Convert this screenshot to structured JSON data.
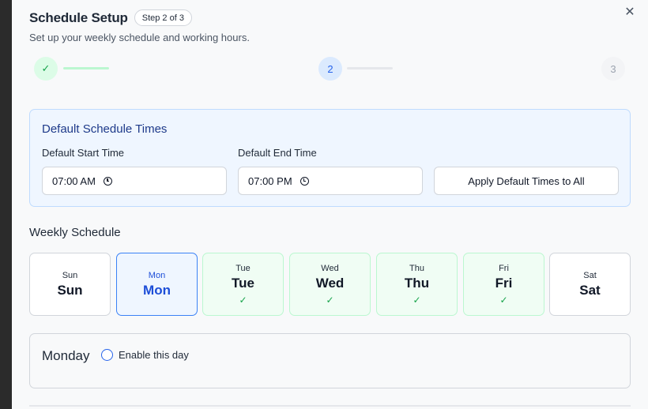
{
  "modal": {
    "title": "Schedule Setup",
    "step_badge": "Step 2 of 3",
    "subtitle": "Set up your weekly schedule and working hours.",
    "close_icon": "✕"
  },
  "stepper": {
    "steps": [
      {
        "label": "✓",
        "state": "complete"
      },
      {
        "label": "2",
        "state": "current"
      },
      {
        "label": "3",
        "state": "upcoming"
      }
    ]
  },
  "defaults": {
    "title": "Default Schedule Times",
    "start_label": "Default Start Time",
    "start_value": "07:00 AM",
    "end_label": "Default End Time",
    "end_value": "07:00 PM",
    "apply_label": "Apply Default Times to All"
  },
  "weekly": {
    "title": "Weekly Schedule",
    "days": [
      {
        "abbr": "Sun",
        "name": "Sun",
        "check": "",
        "state": "off"
      },
      {
        "abbr": "Mon",
        "name": "Mon",
        "check": "",
        "state": "active"
      },
      {
        "abbr": "Tue",
        "name": "Tue",
        "check": "✓",
        "state": "on"
      },
      {
        "abbr": "Wed",
        "name": "Wed",
        "check": "✓",
        "state": "on"
      },
      {
        "abbr": "Thu",
        "name": "Thu",
        "check": "✓",
        "state": "on"
      },
      {
        "abbr": "Fri",
        "name": "Fri",
        "check": "✓",
        "state": "on"
      },
      {
        "abbr": "Sat",
        "name": "Sat",
        "check": "",
        "state": "off"
      }
    ]
  },
  "day_panel": {
    "title": "Monday",
    "enable_label": "Enable this day"
  },
  "colors": {
    "accent": "#2563eb",
    "success": "#16a34a",
    "panel_bg": "#eff6ff"
  }
}
